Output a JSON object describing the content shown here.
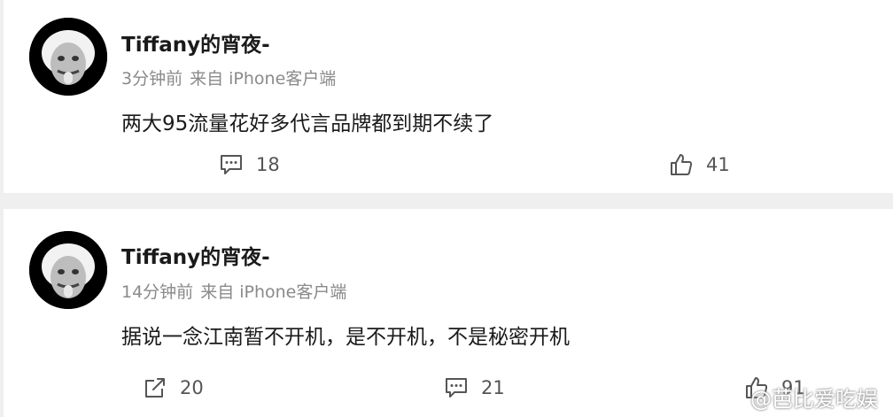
{
  "comments": [
    {
      "username": "Tiffany的宵夜-",
      "time": "3分钟前",
      "source": "来自 iPhone客户端",
      "text": "两大95流量花好多代言品牌都到期不续了",
      "comment_count": "18",
      "like_count": "41"
    },
    {
      "username": "Tiffany的宵夜-",
      "time": "14分钟前",
      "source": "来自 iPhone客户端",
      "text": "据说一念江南暂不开机，是不开机，不是秘密开机",
      "repost_count": "20",
      "comment_count": "21",
      "like_count": "91"
    }
  ],
  "watermark": "@芭比爱吃娱",
  "icons": {
    "avatar": "einstein-tongue-avatar",
    "comment": "comment-icon",
    "like": "thumbs-up-icon",
    "repost": "repost-icon",
    "weibo": "weibo-logo"
  }
}
